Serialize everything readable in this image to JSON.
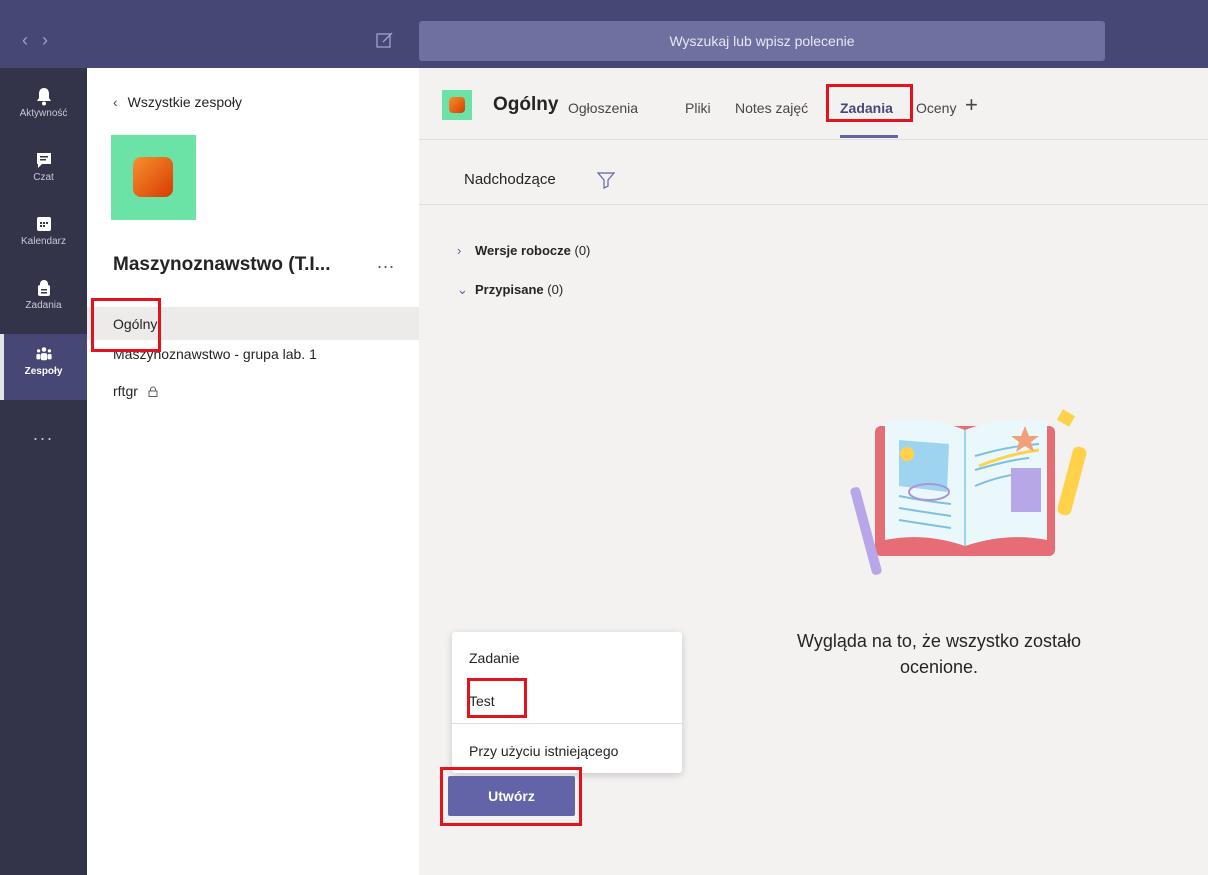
{
  "topbar": {
    "search_placeholder": "Wyszukaj lub wpisz polecenie"
  },
  "rail": {
    "items": [
      {
        "label": "Aktywność",
        "icon": "bell-icon"
      },
      {
        "label": "Czat",
        "icon": "chat-icon"
      },
      {
        "label": "Kalendarz",
        "icon": "calendar-icon"
      },
      {
        "label": "Zadania",
        "icon": "assignments-icon"
      },
      {
        "label": "Zespoły",
        "icon": "teams-icon",
        "active": true
      }
    ],
    "more": "..."
  },
  "teampanel": {
    "back_label": "Wszystkie zespoły",
    "team_name": "Maszynoznawstwo (T.I...",
    "more": "...",
    "channels": [
      {
        "label": "Ogólny",
        "selected": true
      },
      {
        "label": "Maszynoznawstwo - grupa lab. 1"
      },
      {
        "label": "rftgr",
        "locked": true
      }
    ]
  },
  "header": {
    "channel_title": "Ogólny",
    "tabs": [
      "Ogłoszenia",
      "Pliki",
      "Notes zajęć",
      "Zadania",
      "Oceny"
    ],
    "active_tab": "Zadania"
  },
  "filter": {
    "label": "Nadchodzące"
  },
  "sections": {
    "drafts": {
      "label": "Wersje robocze",
      "count": "(0)"
    },
    "assigned": {
      "label": "Przypisane",
      "count": "(0)"
    }
  },
  "empty_state": {
    "message": "Wygląda na to, że wszystko zostało ocenione."
  },
  "create_menu": {
    "items": [
      "Zadanie",
      "Test",
      "Przy użyciu istniejącego"
    ]
  },
  "create_button": {
    "label": "Utwórz"
  },
  "colors": {
    "accent": "#6264a7",
    "highlight": "#e3121e"
  }
}
